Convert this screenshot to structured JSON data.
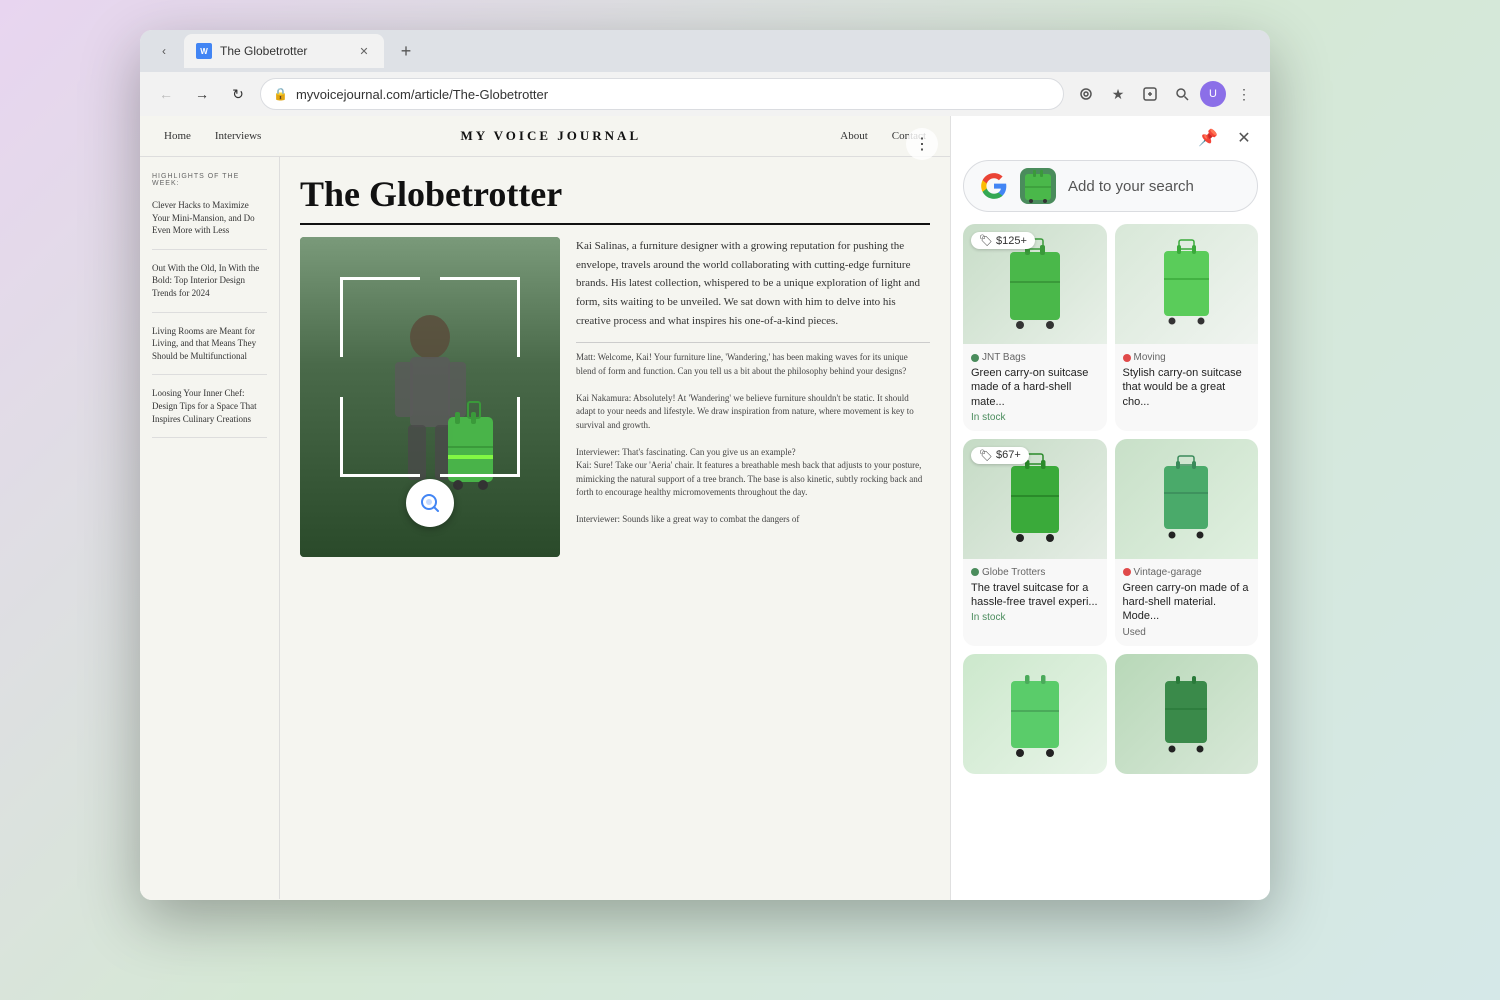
{
  "browser": {
    "tab": {
      "title": "The Globetrotter",
      "favicon": "W"
    },
    "address": "myvoicejournal.com/article/The-Globetrotter",
    "user_avatar": "U"
  },
  "lens_sidebar": {
    "search_placeholder": "Add to your search",
    "pin_btn": "📌",
    "close_btn": "✕",
    "results": [
      {
        "id": "r1",
        "price": "$125+",
        "has_price": true,
        "seller": "JNT Bags",
        "seller_color": "#4a8c5c",
        "title": "Green carry-on suitcase made of a hard-shell mate...",
        "status": "In stock",
        "status_type": "in_stock",
        "img_color": "#5aaa6a"
      },
      {
        "id": "r2",
        "price": "",
        "has_price": false,
        "seller": "Moving",
        "seller_color": "#e04a4a",
        "title": "Stylish carry-on suitcase that would be a great cho...",
        "status": "",
        "status_type": "",
        "img_color": "#4a9a6a"
      },
      {
        "id": "r3",
        "price": "$67+",
        "has_price": true,
        "seller": "Globe Trotters",
        "seller_color": "#4a8c5c",
        "title": "The travel suitcase for a hassle-free travel experi...",
        "status": "In stock",
        "status_type": "in_stock",
        "img_color": "#3a8a5a"
      },
      {
        "id": "r4",
        "price": "",
        "has_price": false,
        "seller": "Vintage-garage",
        "seller_color": "#e04a4a",
        "title": "Green carry-on made of a hard-shell material. Mode...",
        "status": "Used",
        "status_type": "used",
        "img_color": "#4a7a5a"
      },
      {
        "id": "r5",
        "price": "",
        "has_price": false,
        "seller": "",
        "seller_color": "",
        "title": "",
        "status": "",
        "status_type": "",
        "img_color": "#5aaa7a"
      },
      {
        "id": "r6",
        "price": "",
        "has_price": false,
        "seller": "",
        "seller_color": "",
        "title": "",
        "status": "",
        "status_type": "",
        "img_color": "#3a6a4a"
      }
    ]
  },
  "webpage": {
    "nav": {
      "links_left": [
        "Home",
        "Interviews"
      ],
      "logo": "MY VOICE JOURNAL",
      "links_right": [
        "About",
        "Contact"
      ]
    },
    "sidebar": {
      "section_title": "HIGHLIGHTS OF THE WEEK:",
      "items": [
        "Clever Hacks to Maximize Your Mini-Mansion, and Do Even More with Less",
        "Out With the Old, In With the Bold: Top Interior Design Trends for 2024",
        "Living Rooms are Meant for Living, and that Means They Should be Multifunctional",
        "Loosing Your Inner Chef: Design Tips for a Space That Inspires Culinary Creations"
      ]
    },
    "article": {
      "title": "The Globetrotter",
      "body_text": "Kai Salinas, a furniture designer with a growing reputation for pushing the envelope, travels around the world collaborating with cutting-edge furniture brands. His latest collection, whispered to be a unique exploration of light and form, sits waiting to be unveiled. We sat down with him to delve into his creative process and what inspires his one-of-a-kind pieces.",
      "interview": "Matt: Welcome, Kai! Your furniture line, 'Wandering,' has been making waves for its unique blend of form and function. Can you tell us a bit about the philosophy behind your designs?\n\nKai Nakamura: Absolutely! At 'Wandering' we believe furniture shouldn't be static. It should adapt to your needs and lifestyle. We draw inspiration from nature, where movement is key to survival and growth.\n\nInterviewer: That's fascinating. Can you give us an example?\nKai: Sure! Take our 'Aeria' chair. It features a breathable mesh back that adjusts to your posture, mimicking the natural support of a tree branch. The base is also kinetic, subtly rocking back and forth to encourage healthy micromovements throughout the day.\n\nInterviewer: Sounds like a great way to combat the dangers of"
    }
  }
}
